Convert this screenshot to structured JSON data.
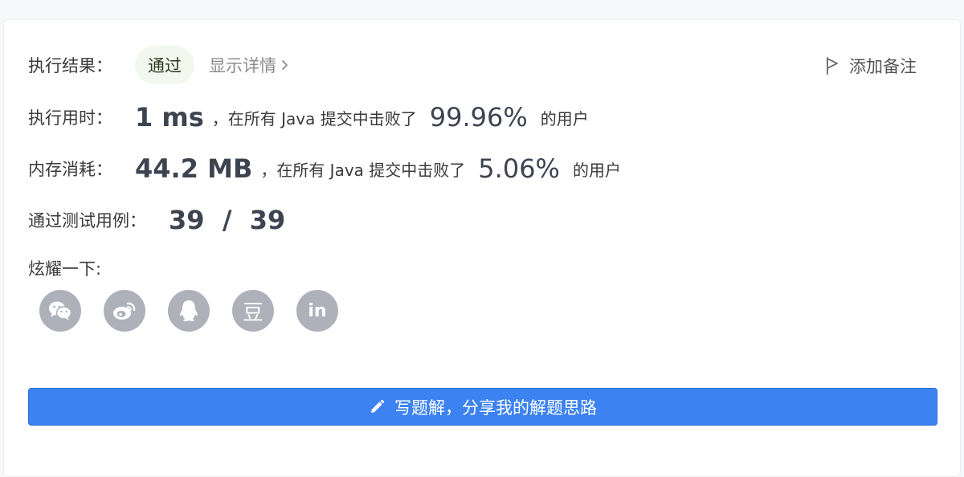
{
  "result": {
    "label": "执行结果：",
    "status": "通过",
    "details_link": "显示详情",
    "add_note": "添加备注"
  },
  "runtime": {
    "label": "执行用时：",
    "value": "1 ms",
    "mid_text": "，在所有 Java 提交中击败了",
    "percent": "99.96%",
    "suffix": "的用户"
  },
  "memory": {
    "label": "内存消耗：",
    "value": "44.2 MB",
    "mid_text": "，在所有 Java 提交中击败了",
    "percent": "5.06%",
    "suffix": "的用户"
  },
  "tests": {
    "label": "通过测试用例：",
    "value": "39  /  39"
  },
  "share": {
    "label": "炫耀一下:",
    "icons": [
      "wechat-icon",
      "weibo-icon",
      "qq-icon",
      "douban-icon",
      "linkedin-icon"
    ],
    "douban_glyph": "豆",
    "linkedin_glyph": "in"
  },
  "solution_button": {
    "label": "写题解，分享我的解题思路"
  },
  "colors": {
    "accent": "#3c82f0",
    "status_bg": "#f3f8ee",
    "share_icon_bg": "#aeb1ba"
  }
}
